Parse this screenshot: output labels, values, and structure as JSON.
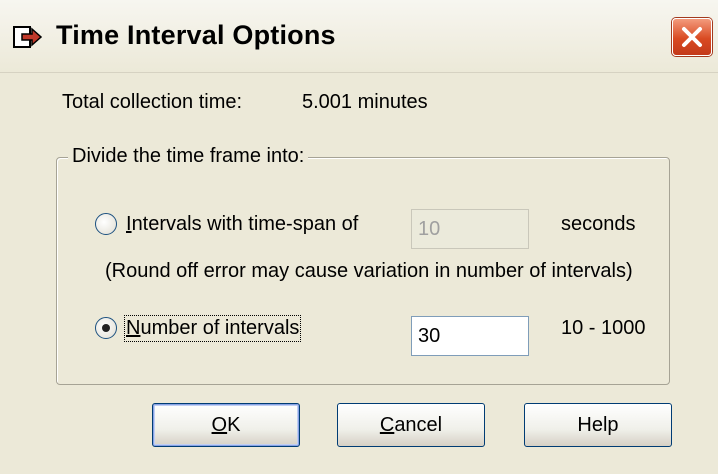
{
  "window": {
    "title": "Time Interval Options",
    "title_icon": "arrow-into-box-icon",
    "close_icon": "close-x-icon"
  },
  "summary": {
    "label": "Total collection time:",
    "value": "5.001 minutes"
  },
  "group": {
    "legend": "Divide the time frame into:",
    "option_timespan": {
      "label_mnemonic": "I",
      "label_rest": "ntervals with time-span of",
      "selected": false,
      "value": "10",
      "enabled": false,
      "unit": "seconds"
    },
    "note": "(Round off error may cause variation in number of intervals)",
    "option_count": {
      "label_mnemonic": "N",
      "label_rest": "umber of intervals",
      "selected": true,
      "value": "30",
      "enabled": true,
      "range": "10 - 1000"
    }
  },
  "buttons": {
    "ok_mnemonic": "O",
    "ok_rest": "K",
    "cancel_mnemonic": "C",
    "cancel_rest": "ancel",
    "help": "Help"
  },
  "colors": {
    "dialog_bg": "#ece9d8",
    "close_button": "#d94a22",
    "button_border": "#003c74"
  }
}
